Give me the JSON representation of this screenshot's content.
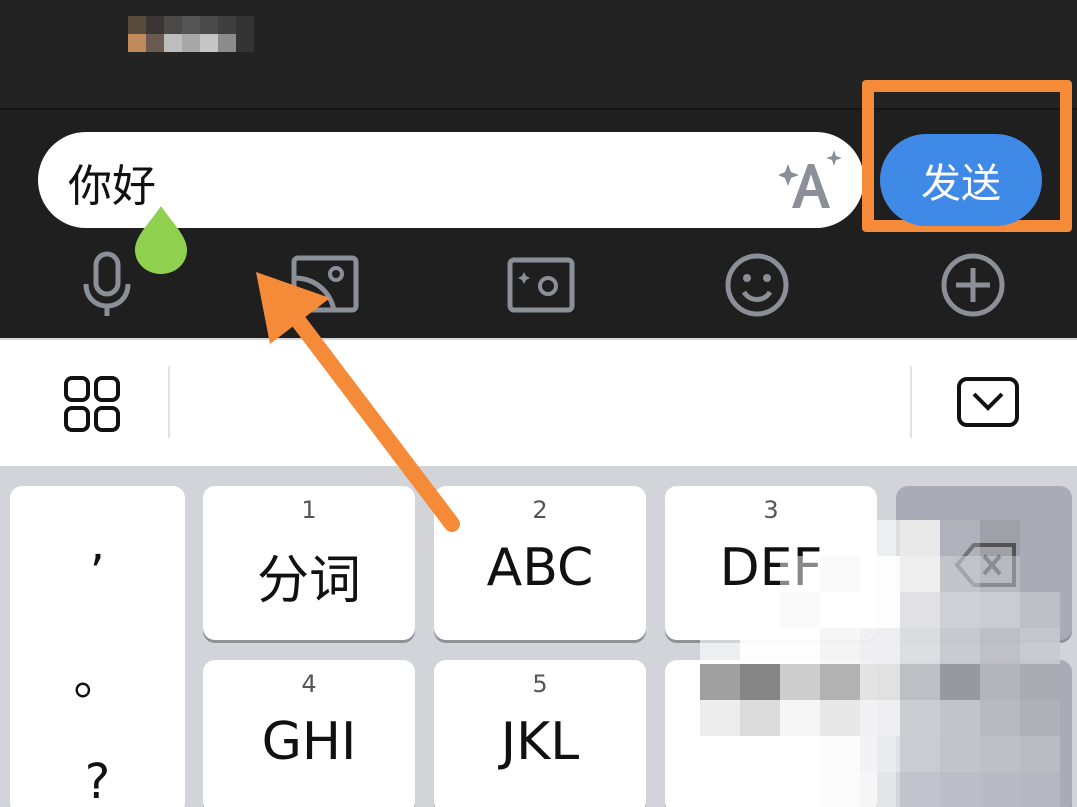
{
  "chat": {
    "message_text": "你好",
    "send_label": "发送"
  },
  "keyboard": {
    "punctuation": [
      ",",
      "。",
      "?"
    ],
    "keys": [
      {
        "num": "1",
        "label": "分词"
      },
      {
        "num": "2",
        "label": "ABC"
      },
      {
        "num": "3",
        "label": "DEF"
      },
      {
        "num": "4",
        "label": "GHI"
      },
      {
        "num": "5",
        "label": "JKL"
      }
    ]
  },
  "colors": {
    "send_button": "#3f8ae6",
    "highlight": "#f58a38",
    "cursor_drop": "#8fd14f"
  }
}
